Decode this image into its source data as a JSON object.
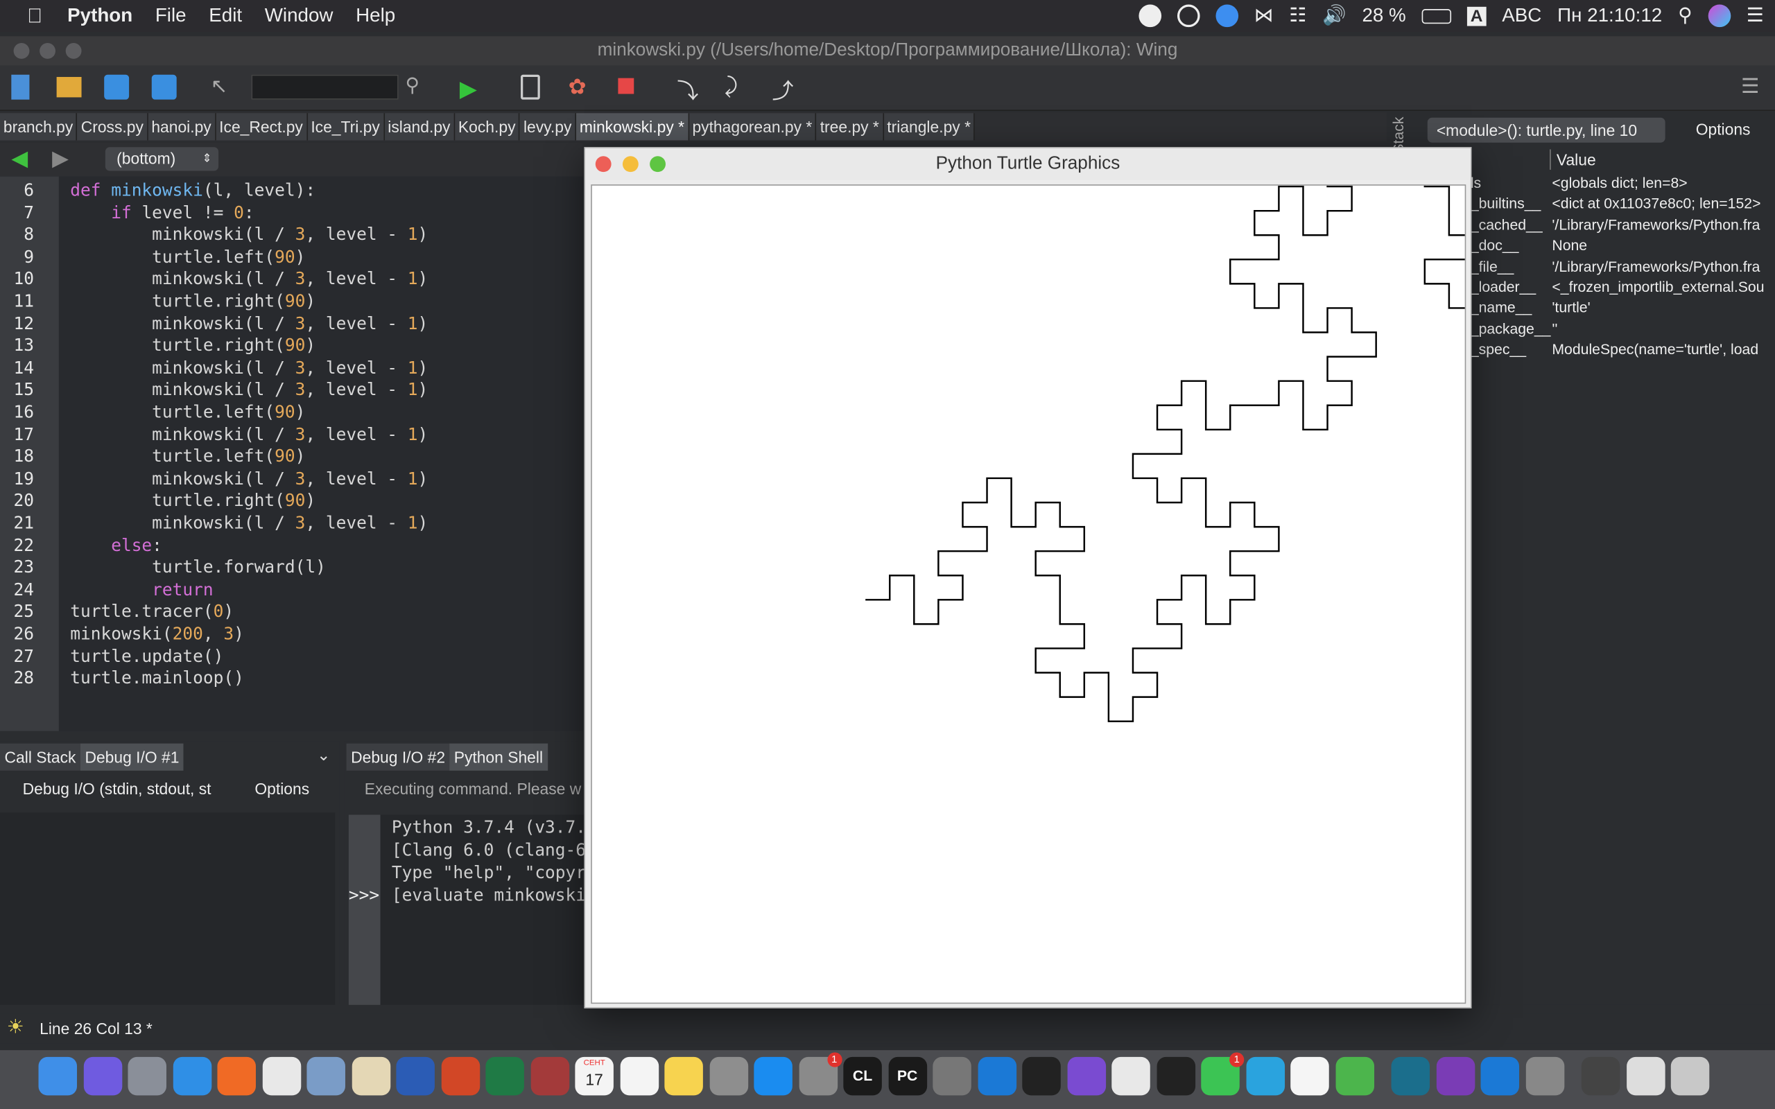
{
  "menubar": {
    "apple": "",
    "app": "Python",
    "items": [
      "File",
      "Edit",
      "Window",
      "Help"
    ],
    "battery": "28 %",
    "input_source": "ABC",
    "input_letter": "A",
    "clock": "Пн 21:10:12"
  },
  "wing": {
    "title": "minkowski.py (/Users/home/Desktop/Программирование/Школа): Wing",
    "tabs": [
      "branch.py",
      "Cross.py",
      "hanoi.py",
      "Ice_Rect.py",
      "Ice_Tri.py",
      "island.py",
      "Koch.py",
      "levy.py",
      "minkowski.py *",
      "pythagorean.py *",
      "tree.py *",
      "triangle.py *"
    ],
    "active_tab": "minkowski.py *",
    "scope_select": "(bottom)",
    "line_numbers": [
      "6",
      "7",
      "8",
      "9",
      "10",
      "11",
      "12",
      "13",
      "14",
      "15",
      "16",
      "17",
      "18",
      "19",
      "20",
      "21",
      "22",
      "23",
      "24",
      "25",
      "26",
      "27",
      "28"
    ],
    "bottom_left_tabs": [
      "Call Stack",
      "Debug I/O #1"
    ],
    "debug_io_label": "Debug I/O (stdin, stdout, st",
    "options_label": "Options",
    "bottom_right_tabs": [
      "Debug I/O #2",
      "Python Shell"
    ],
    "executing": "Executing command.  Please w",
    "shell_lines": [
      "Python 3.7.4 (v3.7.4",
      "[Clang 6.0 (clang-60",
      "Type \"help\", \"copyr",
      "[evaluate minkowski"
    ],
    "shell_prompt": ">>>",
    "status": "Line 26 Col 13 *",
    "stack_tab": "Stack",
    "module_select": "<module>(): turtle.py, line 10",
    "options_right": "Options",
    "value_header": "Value",
    "vars": [
      {
        "k": "ls",
        "v": "<globals dict; len=8>"
      },
      {
        "k": "_builtins__",
        "v": "<dict at 0x11037e8c0; len=152>"
      },
      {
        "k": "_cached__",
        "v": "'/Library/Frameworks/Python.fra"
      },
      {
        "k": "_doc__",
        "v": "None"
      },
      {
        "k": "_file__",
        "v": "'/Library/Frameworks/Python.fra"
      },
      {
        "k": "_loader__",
        "v": "<_frozen_importlib_external.Sou"
      },
      {
        "k": "_name__",
        "v": "'turtle'"
      },
      {
        "k": "_package__",
        "v": "''"
      },
      {
        "k": "_spec__",
        "v": "ModuleSpec(name='turtle', load"
      }
    ]
  },
  "code": [
    [
      [
        "kw",
        "def "
      ],
      [
        "fn",
        "minkowski"
      ],
      [
        "pl",
        "(l, level):"
      ]
    ],
    [
      [
        "pl",
        "    "
      ],
      [
        "kw",
        "if "
      ],
      [
        "pl",
        "level != "
      ],
      [
        "nm",
        "0"
      ],
      [
        "pl",
        ":"
      ]
    ],
    [
      [
        "pl",
        "        minkowski(l / "
      ],
      [
        "nm",
        "3"
      ],
      [
        "pl",
        ", level - "
      ],
      [
        "nm",
        "1"
      ],
      [
        "pl",
        ")"
      ]
    ],
    [
      [
        "pl",
        "        turtle.left("
      ],
      [
        "nm",
        "90"
      ],
      [
        "pl",
        ")"
      ]
    ],
    [
      [
        "pl",
        "        minkowski(l / "
      ],
      [
        "nm",
        "3"
      ],
      [
        "pl",
        ", level - "
      ],
      [
        "nm",
        "1"
      ],
      [
        "pl",
        ")"
      ]
    ],
    [
      [
        "pl",
        "        turtle.right("
      ],
      [
        "nm",
        "90"
      ],
      [
        "pl",
        ")"
      ]
    ],
    [
      [
        "pl",
        "        minkowski(l / "
      ],
      [
        "nm",
        "3"
      ],
      [
        "pl",
        ", level - "
      ],
      [
        "nm",
        "1"
      ],
      [
        "pl",
        ")"
      ]
    ],
    [
      [
        "pl",
        "        turtle.right("
      ],
      [
        "nm",
        "90"
      ],
      [
        "pl",
        ")"
      ]
    ],
    [
      [
        "pl",
        "        minkowski(l / "
      ],
      [
        "nm",
        "3"
      ],
      [
        "pl",
        ", level - "
      ],
      [
        "nm",
        "1"
      ],
      [
        "pl",
        ")"
      ]
    ],
    [
      [
        "pl",
        "        minkowski(l / "
      ],
      [
        "nm",
        "3"
      ],
      [
        "pl",
        ", level - "
      ],
      [
        "nm",
        "1"
      ],
      [
        "pl",
        ")"
      ]
    ],
    [
      [
        "pl",
        "        turtle.left("
      ],
      [
        "nm",
        "90"
      ],
      [
        "pl",
        ")"
      ]
    ],
    [
      [
        "pl",
        "        minkowski(l / "
      ],
      [
        "nm",
        "3"
      ],
      [
        "pl",
        ", level - "
      ],
      [
        "nm",
        "1"
      ],
      [
        "pl",
        ")"
      ]
    ],
    [
      [
        "pl",
        "        turtle.left("
      ],
      [
        "nm",
        "90"
      ],
      [
        "pl",
        ")"
      ]
    ],
    [
      [
        "pl",
        "        minkowski(l / "
      ],
      [
        "nm",
        "3"
      ],
      [
        "pl",
        ", level - "
      ],
      [
        "nm",
        "1"
      ],
      [
        "pl",
        ")"
      ]
    ],
    [
      [
        "pl",
        "        turtle.right("
      ],
      [
        "nm",
        "90"
      ],
      [
        "pl",
        ")"
      ]
    ],
    [
      [
        "pl",
        "        minkowski(l / "
      ],
      [
        "nm",
        "3"
      ],
      [
        "pl",
        ", level - "
      ],
      [
        "nm",
        "1"
      ],
      [
        "pl",
        ")"
      ]
    ],
    [
      [
        "pl",
        "    "
      ],
      [
        "kw",
        "else"
      ],
      [
        "pl",
        ":"
      ]
    ],
    [
      [
        "pl",
        "        turtle.forward(l)"
      ]
    ],
    [
      [
        "pl",
        "        "
      ],
      [
        "kw",
        "return"
      ]
    ],
    [
      [
        "pl",
        "turtle.tracer("
      ],
      [
        "nm",
        "0"
      ],
      [
        "pl",
        ")"
      ]
    ],
    [
      [
        "pl",
        "minkowski("
      ],
      [
        "nm",
        "200"
      ],
      [
        "pl",
        ", "
      ],
      [
        "nm",
        "3"
      ],
      [
        "pl",
        ")"
      ]
    ],
    [
      [
        "pl",
        "turtle.update()"
      ]
    ],
    [
      [
        "pl",
        "turtle.mainloop()"
      ]
    ]
  ],
  "turtle": {
    "title": "Python Turtle Graphics",
    "fractal_length": 200,
    "fractal_level": 3
  },
  "dock": {
    "icons": [
      "finder-icon",
      "siri-icon",
      "launchpad-icon",
      "safari-icon",
      "firefox-icon",
      "chrome-icon",
      "preview-icon",
      "scripts-icon",
      "word-icon",
      "powerpoint-icon",
      "excel-icon",
      "dictionary-icon",
      "calendar-icon",
      "reminders-icon",
      "notes-icon",
      "calculator-icon",
      "app-store-icon",
      "system-preferences-icon",
      "clion-icon",
      "pycharm-icon",
      "feather-icon",
      "xcode-icon",
      "terminal-icon",
      "imovie-star-icon",
      "textedit-icon",
      "activity-monitor-icon",
      "whatsapp-icon",
      "telegram-icon",
      "music-icon",
      "maps-icon",
      "eset-icon",
      "onenote-icon",
      "onedrive-icon",
      "rocket-icon",
      "screenshot-icon",
      "preview-doc-icon",
      "trash-icon"
    ],
    "calendar_month": "СЕНТ",
    "calendar_day": "17",
    "badge_sysprefs": "1",
    "badge_whatsapp": "1",
    "clion_label": "CL",
    "pycharm_label": "PC"
  }
}
